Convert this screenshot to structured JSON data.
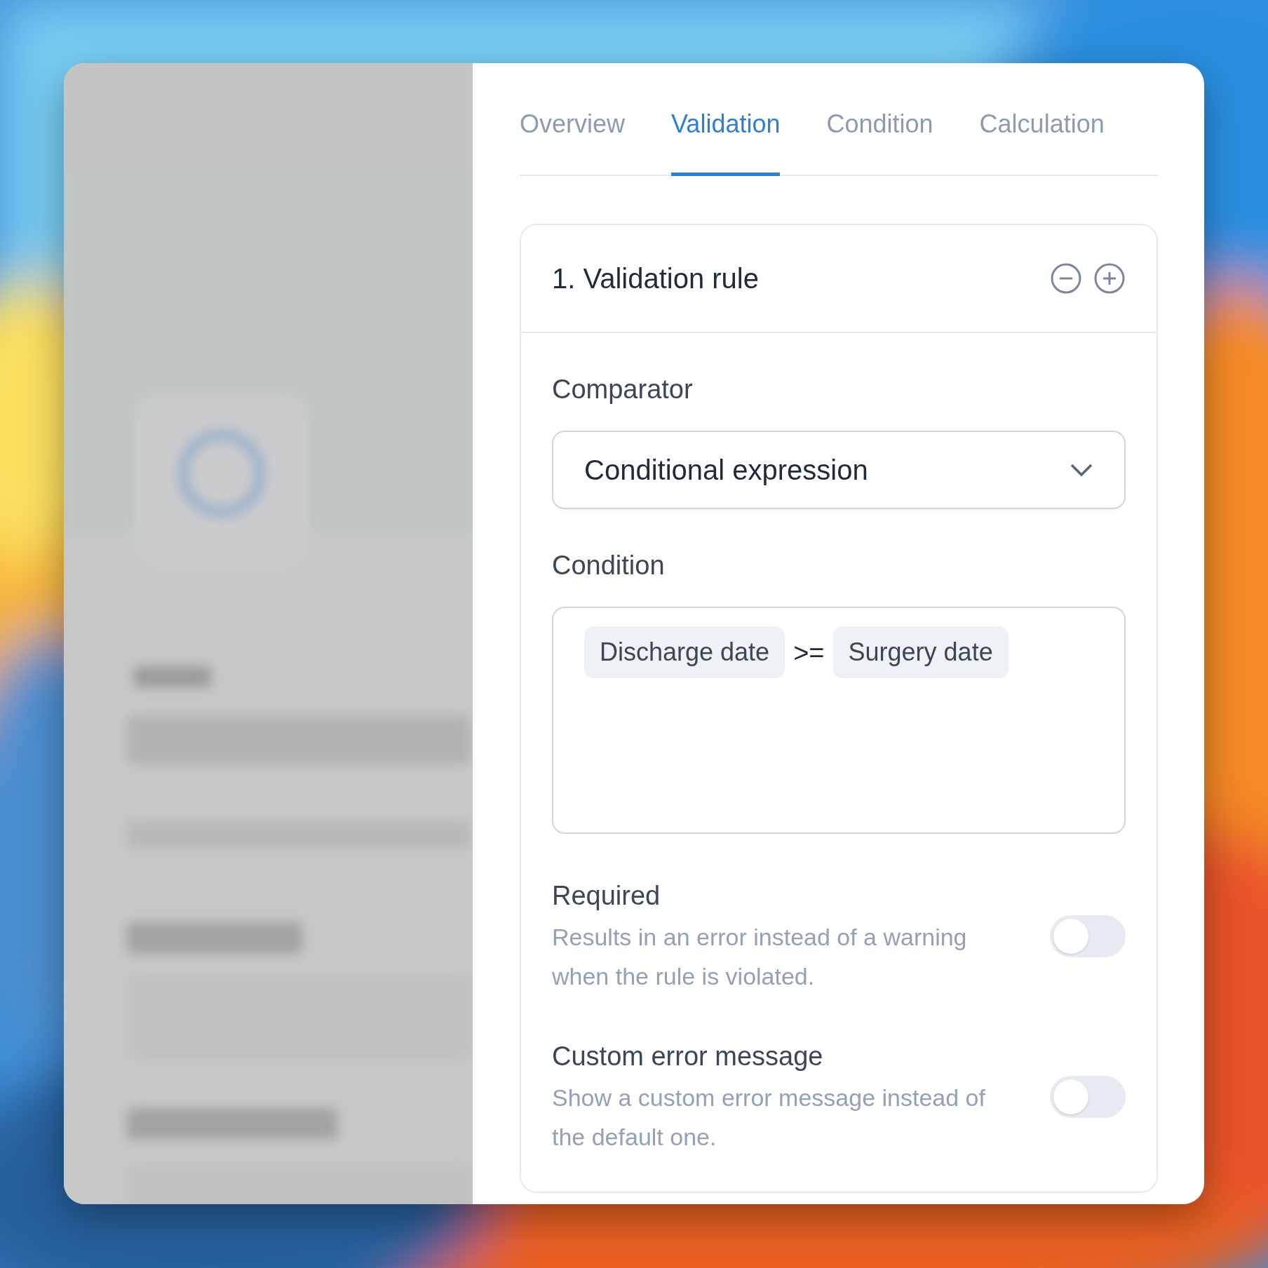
{
  "tabs": [
    {
      "label": "Overview",
      "selected": false
    },
    {
      "label": "Validation",
      "selected": true
    },
    {
      "label": "Condition",
      "selected": false
    },
    {
      "label": "Calculation",
      "selected": false
    }
  ],
  "rule": {
    "title": "1. Validation rule",
    "comparator": {
      "label": "Comparator",
      "value": "Conditional expression"
    },
    "condition": {
      "label": "Condition",
      "tokens": [
        {
          "kind": "field",
          "text": "Discharge date"
        },
        {
          "kind": "operator",
          "text": ">="
        },
        {
          "kind": "field",
          "text": "Surgery date"
        }
      ]
    },
    "toggles": [
      {
        "title": "Required",
        "description": "Results in an error instead of a warning when the rule is violated.",
        "on": false
      },
      {
        "title": "Custom error message",
        "description": "Show a custom error message instead of the default one.",
        "on": false
      }
    ]
  }
}
